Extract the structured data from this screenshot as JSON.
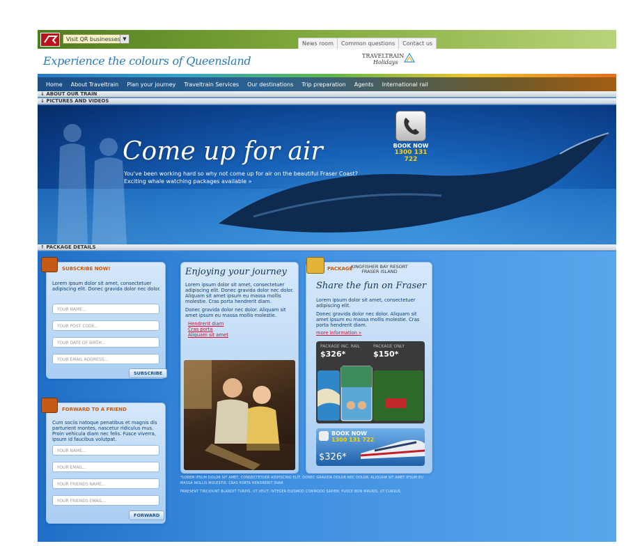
{
  "topbar": {
    "select_value": "Visit QR businesses...",
    "links": [
      "News room",
      "Common questions",
      "Contact us"
    ]
  },
  "header": {
    "tagline": "Experience the colours of Queensland",
    "brand_line1": "TRAVELTRAIN",
    "brand_line2": "Holidays"
  },
  "nav": {
    "items": [
      "Home",
      "About Traveltrain",
      "Plan your journey",
      "Traveltrain Services",
      "Our destinations",
      "Trip preparation",
      "Agents",
      "International rail"
    ]
  },
  "strips": {
    "about": "ABOUT OUR TRAIN",
    "pictures": "PICTURES AND VIDEOS",
    "package": "PACKAGE DETAILS"
  },
  "hero": {
    "title": "Come up for air",
    "sub1": "You've been working hard so        why not come up for air on the beautiful Fraser Coast?",
    "sub2": "Exciting whale watching packages available »",
    "book_label": "BOOK NOW",
    "book_number": "1300 131 722"
  },
  "subscribe": {
    "title": "SUBSCRIBE NOW!",
    "text": "Lorem ipsum dolor sit amet, consectetuer adipiscing elit. Donec gravida dolor nec dolor.",
    "fields": [
      "YOUR NAME...",
      "YOUR POST CODE...",
      "YOUR DATE OF BIRTH...",
      "YOUR EMAIL ADDRESS..."
    ],
    "button": "SUBSCRIBE"
  },
  "forward": {
    "title": "FORWARD TO A FRIEND",
    "text": "Cum sociis natoque penatibus et magnis dis parturient montes, nascetur ridiculus mus. Proin vehicula diam nec felis. Fusce viverra, ipsum id faucibus volutpat.",
    "fields": [
      "YOUR NAME...",
      "YOUR EMAIL...",
      "YOUR FRIENDS NAME...",
      "YOUR FRIENDS EMAIL..."
    ],
    "button": "FORWARD"
  },
  "journey": {
    "title": "Enjoying your journey",
    "p1": "Lorem ipsum dolor sit amet, consectetuer adipiscing elit. Donec gravida dolor nec dolor. Aliquam sit amet ipsum eu massa mollis molestie. Cras porta hendrerit diam.",
    "p2": "Donec gravida dolor nec dolor. Aliquam sit amet ipsum eu massa mollis molestie.",
    "links": [
      "Hendrerit diam",
      "Cras porta",
      "Aliquam sit amet"
    ]
  },
  "package": {
    "label": "PACKAGE",
    "name1": "KINGFISHER BAY RESORT",
    "name2": "FRASER ISLAND",
    "title": "Share the fun on Fraser",
    "p1": "Lorem ipsum dolor sit amet, consectetuer adipiscing elit.",
    "p2": "Donec gravida dolor nec dolor. Aliquam sit amet ipsum eu massa mollis molestie. Cras porta hendrerit diam.",
    "more": "more information »",
    "rail_label": "PACKAGE INC. RAIL",
    "rail_price": "$326*",
    "only_label": "PACKAGE ONLY",
    "only_price": "$150*",
    "book_label": "BOOK NOW",
    "book_number": "1300 131 722",
    "train_price": "$326*"
  },
  "footer": {
    "line1": "*Lorem ipsum dolor sit amet, consectetuer adipiscing elit. Donec gravida dolor nec dolor. Aliquam sit amet ipsum eu massa mollis molestie. Cras porta hendrerit diam.",
    "line2": "Praesent tincidunt blandit turpis, ut velit. Integer euismod commodo sapien. Fusce non mauris. Ut cursus."
  }
}
